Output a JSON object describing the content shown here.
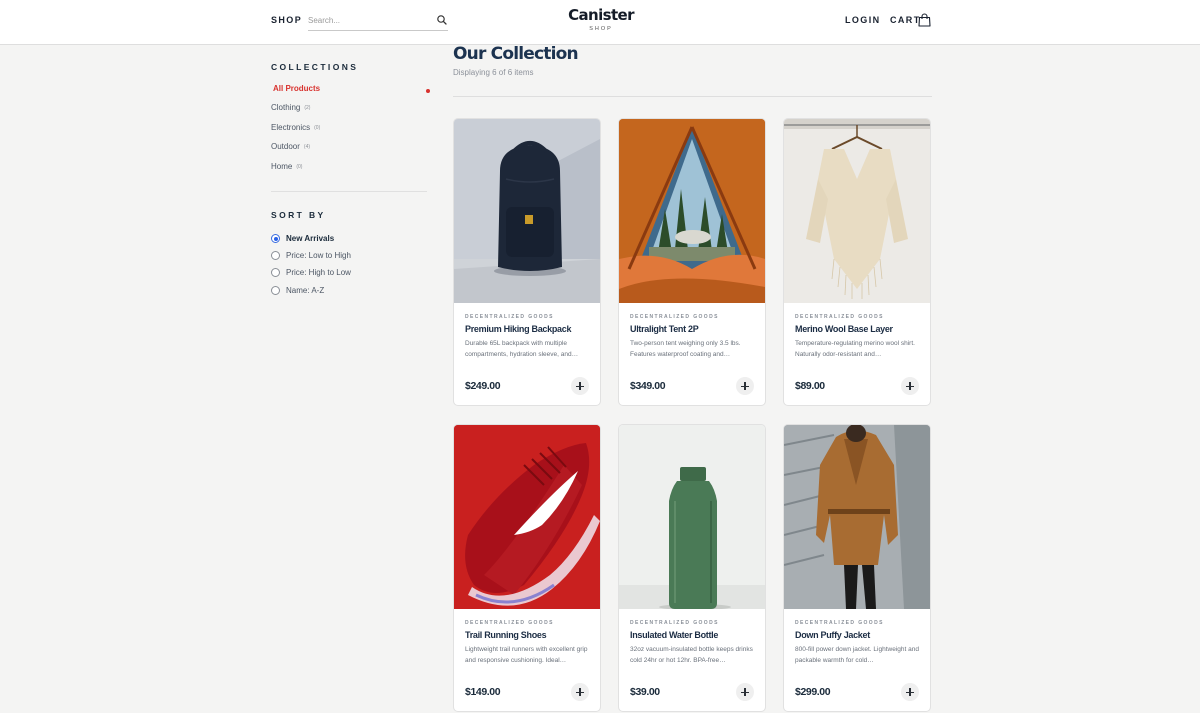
{
  "header": {
    "shop_label": "SHOP",
    "search_placeholder": "Search...",
    "logo": "Canister",
    "logo_sub": "SHOP",
    "login_label": "LOGIN",
    "cart_label": "CART"
  },
  "sidebar": {
    "collections_title": "COLLECTIONS",
    "collections": [
      {
        "label": "All Products",
        "count": "",
        "active": true
      },
      {
        "label": "Clothing",
        "count": "(2)"
      },
      {
        "label": "Electronics",
        "count": "(0)"
      },
      {
        "label": "Outdoor",
        "count": "(4)"
      },
      {
        "label": "Home",
        "count": "(0)"
      }
    ],
    "sort_title": "SORT BY",
    "sort_options": [
      {
        "label": "New Arrivals",
        "selected": true
      },
      {
        "label": "Price: Low to High"
      },
      {
        "label": "Price: High to Low"
      },
      {
        "label": "Name: A-Z"
      }
    ]
  },
  "main": {
    "title": "Our Collection",
    "subtitle": "Displaying 6 of 6 items"
  },
  "products": [
    {
      "brand": "DECENTRALIZED GOODS",
      "name": "Premium Hiking Backpack",
      "desc": "Durable 65L backpack with multiple compartments, hydration sleeve, and…",
      "price": "$249.00"
    },
    {
      "brand": "DECENTRALIZED GOODS",
      "name": "Ultralight Tent 2P",
      "desc": "Two-person tent weighing only 3.5 lbs. Features waterproof coating and…",
      "price": "$349.00"
    },
    {
      "brand": "DECENTRALIZED GOODS",
      "name": "Merino Wool Base Layer",
      "desc": "Temperature-regulating merino wool shirt. Naturally odor-resistant and…",
      "price": "$89.00"
    },
    {
      "brand": "DECENTRALIZED GOODS",
      "name": "Trail Running Shoes",
      "desc": "Lightweight trail runners with excellent grip and responsive cushioning. Ideal…",
      "price": "$149.00"
    },
    {
      "brand": "DECENTRALIZED GOODS",
      "name": "Insulated Water Bottle",
      "desc": "32oz vacuum-insulated bottle keeps drinks cold 24hr or hot 12hr. BPA-free…",
      "price": "$39.00"
    },
    {
      "brand": "DECENTRALIZED GOODS",
      "name": "Down Puffy Jacket",
      "desc": "800-fill power down jacket. Lightweight and packable warmth for cold…",
      "price": "$299.00"
    }
  ],
  "colors": {
    "accent": "#d8322e",
    "radio_selected": "#2b62e8",
    "heading": "#1c3350"
  },
  "icons": [
    "search-icon",
    "shopping-bag-icon",
    "plus-icon"
  ]
}
